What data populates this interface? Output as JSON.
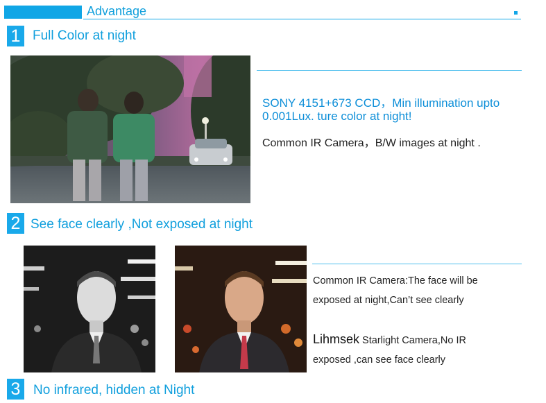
{
  "header": {
    "title": "Advantage"
  },
  "sections": [
    {
      "number": "1",
      "title": "Full Color at night"
    },
    {
      "number": "2",
      "title": "See face clearly ,Not exposed at night"
    },
    {
      "number": "3",
      "title": "No infrared, hidden at Night"
    }
  ],
  "section1": {
    "spec_line1": "SONY 4151+673 CCD，Min illumination upto",
    "spec_line2": "0.001Lux. ture color at night!",
    "compare": "Common IR Camera，B/W images at night ."
  },
  "section2": {
    "common_line1": "Common IR Camera:The face will be",
    "common_line2": "exposed at night,Can’t see clearly",
    "brand": "Lihmsek",
    "starlight_line1": " Starlight Camera,No IR",
    "starlight_line2": "exposed ,can see face clearly"
  },
  "colors": {
    "accent": "#10a6e6",
    "text_blue": "#0c8ed8"
  }
}
